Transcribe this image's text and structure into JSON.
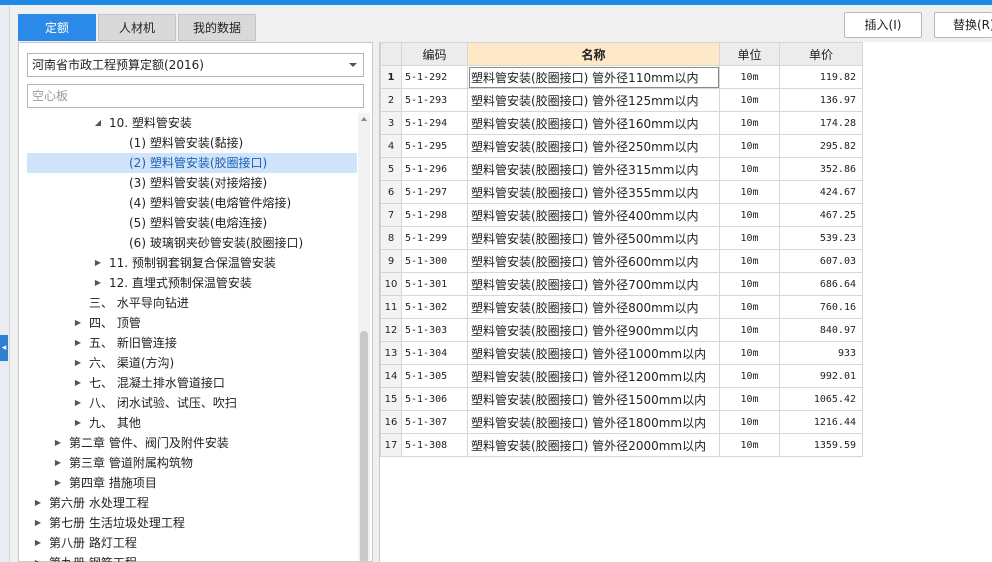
{
  "tabs": [
    "定额",
    "人材机",
    "我的数据"
  ],
  "toolbar": {
    "insert_label": "插入(I)",
    "replace_label": "替换(R)"
  },
  "left_panel": {
    "library_select": "河南省市政工程预算定额(2016)",
    "search_value": "空心板",
    "tree": [
      {
        "label": "10. 塑料管安装",
        "indent": 3,
        "expander": "open"
      },
      {
        "label": "(1) 塑料管安装(黏接)",
        "indent": 4,
        "expander": "none"
      },
      {
        "label": "(2) 塑料管安装(胶圈接口)",
        "indent": 4,
        "expander": "none",
        "selected": true
      },
      {
        "label": "(3) 塑料管安装(对接熔接)",
        "indent": 4,
        "expander": "none"
      },
      {
        "label": "(4) 塑料管安装(电熔管件熔接)",
        "indent": 4,
        "expander": "none"
      },
      {
        "label": "(5) 塑料管安装(电熔连接)",
        "indent": 4,
        "expander": "none"
      },
      {
        "label": "(6) 玻璃钢夹砂管安装(胶圈接口)",
        "indent": 4,
        "expander": "none"
      },
      {
        "label": "11. 预制钢套钢复合保温管安装",
        "indent": 3,
        "expander": "closed"
      },
      {
        "label": "12. 直埋式预制保温管安装",
        "indent": 3,
        "expander": "closed"
      },
      {
        "label": "三、 水平导向钻进",
        "indent": 2,
        "expander": "none"
      },
      {
        "label": "四、 顶管",
        "indent": 2,
        "expander": "closed"
      },
      {
        "label": "五、 新旧管连接",
        "indent": 2,
        "expander": "closed"
      },
      {
        "label": "六、 渠道(方沟)",
        "indent": 2,
        "expander": "closed"
      },
      {
        "label": "七、 混凝土排水管道接口",
        "indent": 2,
        "expander": "closed"
      },
      {
        "label": "八、 闭水试验、试压、吹扫",
        "indent": 2,
        "expander": "closed"
      },
      {
        "label": "九、 其他",
        "indent": 2,
        "expander": "closed"
      },
      {
        "label": "第二章 管件、阀门及附件安装",
        "indent": 1,
        "expander": "closed"
      },
      {
        "label": "第三章 管道附属构筑物",
        "indent": 1,
        "expander": "closed"
      },
      {
        "label": "第四章 措施项目",
        "indent": 1,
        "expander": "closed"
      },
      {
        "label": "第六册 水处理工程",
        "indent": 0,
        "expander": "closed"
      },
      {
        "label": "第七册 生活垃圾处理工程",
        "indent": 0,
        "expander": "closed"
      },
      {
        "label": "第八册 路灯工程",
        "indent": 0,
        "expander": "closed"
      },
      {
        "label": "第九册 钢筋工程",
        "indent": 0,
        "expander": "closed"
      }
    ]
  },
  "grid": {
    "headers": [
      "编码",
      "名称",
      "单位",
      "单价"
    ],
    "rows": [
      {
        "n": "1",
        "code": "5-1-292",
        "name": "塑料管安装(胶圈接口) 管外径110mm以内",
        "unit": "10m",
        "price": "119.82"
      },
      {
        "n": "2",
        "code": "5-1-293",
        "name": "塑料管安装(胶圈接口) 管外径125mm以内",
        "unit": "10m",
        "price": "136.97"
      },
      {
        "n": "3",
        "code": "5-1-294",
        "name": "塑料管安装(胶圈接口) 管外径160mm以内",
        "unit": "10m",
        "price": "174.28"
      },
      {
        "n": "4",
        "code": "5-1-295",
        "name": "塑料管安装(胶圈接口) 管外径250mm以内",
        "unit": "10m",
        "price": "295.82"
      },
      {
        "n": "5",
        "code": "5-1-296",
        "name": "塑料管安装(胶圈接口) 管外径315mm以内",
        "unit": "10m",
        "price": "352.86"
      },
      {
        "n": "6",
        "code": "5-1-297",
        "name": "塑料管安装(胶圈接口) 管外径355mm以内",
        "unit": "10m",
        "price": "424.67"
      },
      {
        "n": "7",
        "code": "5-1-298",
        "name": "塑料管安装(胶圈接口) 管外径400mm以内",
        "unit": "10m",
        "price": "467.25"
      },
      {
        "n": "8",
        "code": "5-1-299",
        "name": "塑料管安装(胶圈接口) 管外径500mm以内",
        "unit": "10m",
        "price": "539.23"
      },
      {
        "n": "9",
        "code": "5-1-300",
        "name": "塑料管安装(胶圈接口) 管外径600mm以内",
        "unit": "10m",
        "price": "607.03"
      },
      {
        "n": "10",
        "code": "5-1-301",
        "name": "塑料管安装(胶圈接口) 管外径700mm以内",
        "unit": "10m",
        "price": "686.64"
      },
      {
        "n": "11",
        "code": "5-1-302",
        "name": "塑料管安装(胶圈接口) 管外径800mm以内",
        "unit": "10m",
        "price": "760.16"
      },
      {
        "n": "12",
        "code": "5-1-303",
        "name": "塑料管安装(胶圈接口) 管外径900mm以内",
        "unit": "10m",
        "price": "840.97"
      },
      {
        "n": "13",
        "code": "5-1-304",
        "name": "塑料管安装(胶圈接口) 管外径1000mm以内",
        "unit": "10m",
        "price": "933"
      },
      {
        "n": "14",
        "code": "5-1-305",
        "name": "塑料管安装(胶圈接口) 管外径1200mm以内",
        "unit": "10m",
        "price": "992.01"
      },
      {
        "n": "15",
        "code": "5-1-306",
        "name": "塑料管安装(胶圈接口) 管外径1500mm以内",
        "unit": "10m",
        "price": "1065.42"
      },
      {
        "n": "16",
        "code": "5-1-307",
        "name": "塑料管安装(胶圈接口) 管外径1800mm以内",
        "unit": "10m",
        "price": "1216.44"
      },
      {
        "n": "17",
        "code": "5-1-308",
        "name": "塑料管安装(胶圈接口) 管外径2000mm以内",
        "unit": "10m",
        "price": "1359.59"
      }
    ]
  },
  "colors": {
    "accent": "#2b8ae8",
    "selected_row": "#cfe4fa",
    "name_header": "#fde9c8"
  }
}
